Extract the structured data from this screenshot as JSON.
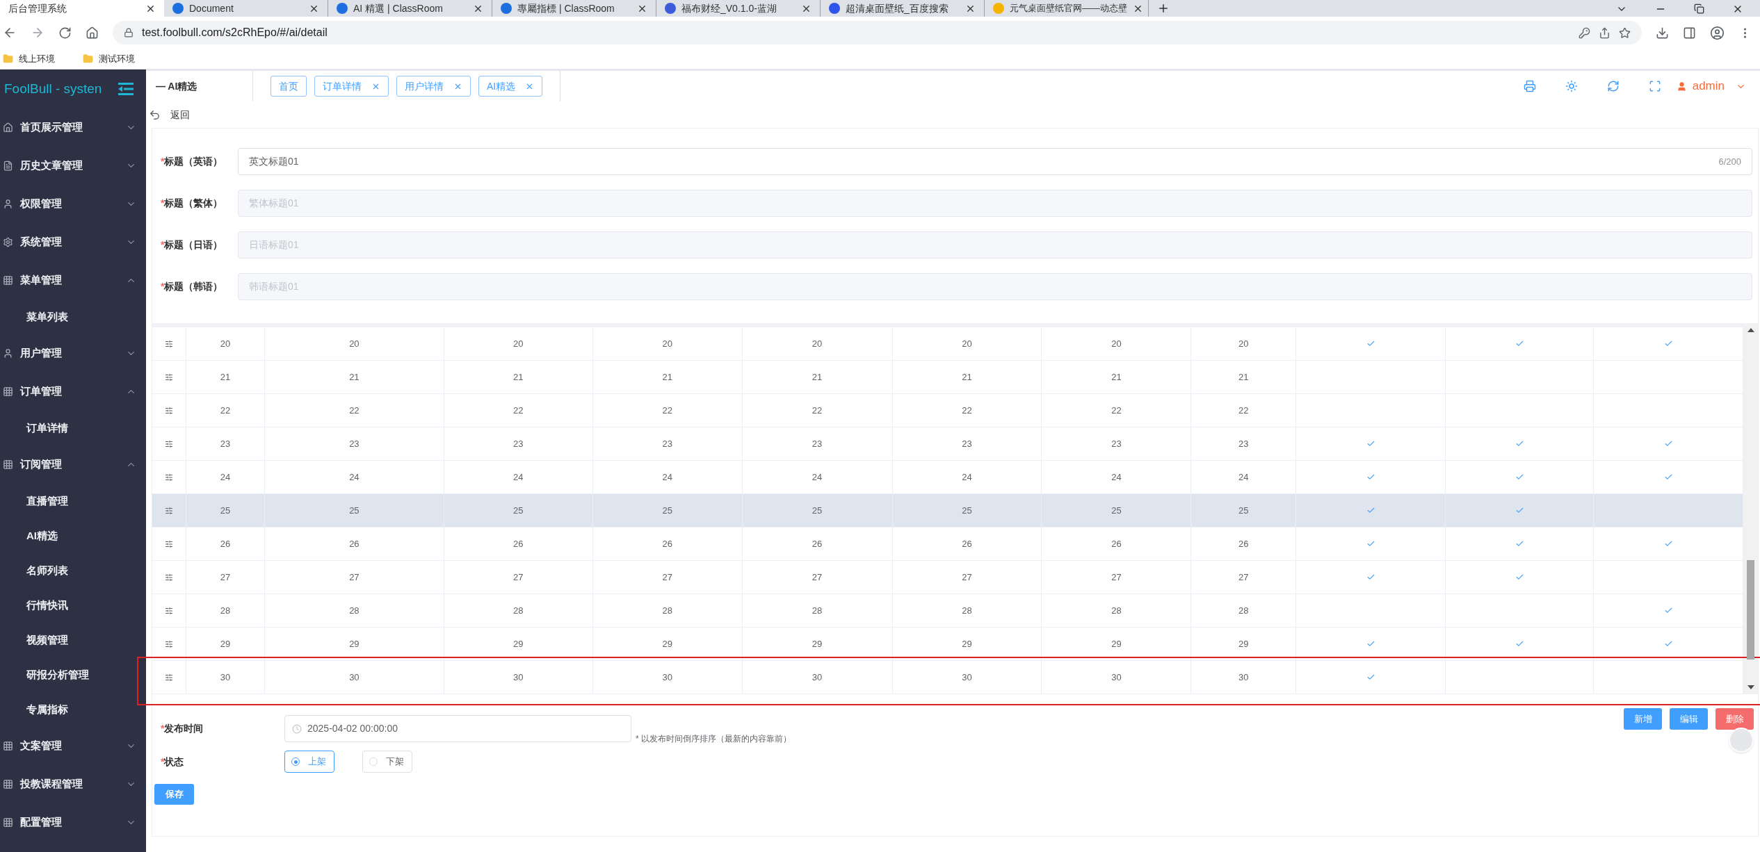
{
  "browser": {
    "tabs": [
      {
        "title": "后台管理系统",
        "selected": true
      },
      {
        "title": "Document",
        "selected": false
      },
      {
        "title": "AI 精選 | ClassRoom",
        "selected": false
      },
      {
        "title": "專屬指標 | ClassRoom",
        "selected": false
      },
      {
        "title": "福布财经_V0.1.0-蓝湖",
        "selected": false
      },
      {
        "title": "超清桌面壁纸_百度搜索",
        "selected": false
      },
      {
        "title": "元气桌面壁纸官网——动态壁",
        "selected": false
      }
    ],
    "url": "test.foolbull.com/s2cRhEpo/#/ai/detail",
    "bookmarks": [
      "线上环境",
      "测试环境"
    ]
  },
  "sidebar": {
    "logo": "FoolBull - systen",
    "items": [
      {
        "label": "首页展示管理",
        "expanded": false
      },
      {
        "label": "历史文章管理",
        "expanded": false
      },
      {
        "label": "权限管理",
        "expanded": false
      },
      {
        "label": "系统管理",
        "expanded": false
      },
      {
        "label": "菜单管理",
        "expanded": true,
        "children": [
          {
            "label": "菜单列表"
          }
        ]
      },
      {
        "label": "用户管理",
        "expanded": false
      },
      {
        "label": "订单管理",
        "expanded": true,
        "children": [
          {
            "label": "订单详情"
          }
        ]
      },
      {
        "label": "订阅管理",
        "expanded": true,
        "children": [
          {
            "label": "直播管理"
          },
          {
            "label": "AI精选"
          },
          {
            "label": "名师列表"
          },
          {
            "label": "行情快讯"
          },
          {
            "label": "视频管理"
          },
          {
            "label": "研报分析管理"
          },
          {
            "label": "专属指标"
          }
        ]
      },
      {
        "label": "文案管理",
        "expanded": false
      },
      {
        "label": "投教课程管理",
        "expanded": false
      },
      {
        "label": "配置管理",
        "expanded": false
      }
    ]
  },
  "header": {
    "breadcrumb": "— AI精选",
    "tabs": [
      {
        "label": "首页",
        "closable": false
      },
      {
        "label": "订单详情",
        "closable": true
      },
      {
        "label": "用户详情",
        "closable": true
      },
      {
        "label": "AI精选",
        "closable": true
      }
    ],
    "user": "admin"
  },
  "back": "返回",
  "fields": [
    {
      "required_mark": "*",
      "label": "标题（英语）",
      "value": "英文标题01",
      "disabled": false,
      "counter": "6/200"
    },
    {
      "required_mark": "*",
      "label": "标题（繁体）",
      "value": "繁体标题01",
      "disabled": true
    },
    {
      "required_mark": "*",
      "label": "标题（日语）",
      "value": "日语标题01",
      "disabled": true
    },
    {
      "required_mark": "*",
      "label": "标题（韩语）",
      "value": "韩语标题01",
      "disabled": true
    }
  ],
  "table": {
    "rows": [
      {
        "values": [
          "20",
          "20",
          "20",
          "20",
          "20",
          "20",
          "20",
          "20"
        ],
        "checks": [
          true,
          true,
          true
        ],
        "hovered": false,
        "outlined": false
      },
      {
        "values": [
          "21",
          "21",
          "21",
          "21",
          "21",
          "21",
          "21",
          "21"
        ],
        "checks": [
          false,
          false,
          false
        ],
        "hovered": false,
        "outlined": false
      },
      {
        "values": [
          "22",
          "22",
          "22",
          "22",
          "22",
          "22",
          "22",
          "22"
        ],
        "checks": [
          false,
          false,
          false
        ],
        "hovered": false,
        "outlined": false
      },
      {
        "values": [
          "23",
          "23",
          "23",
          "23",
          "23",
          "23",
          "23",
          "23"
        ],
        "checks": [
          true,
          true,
          true
        ],
        "hovered": false,
        "outlined": false
      },
      {
        "values": [
          "24",
          "24",
          "24",
          "24",
          "24",
          "24",
          "24",
          "24"
        ],
        "checks": [
          true,
          true,
          true
        ],
        "hovered": false,
        "outlined": false
      },
      {
        "values": [
          "25",
          "25",
          "25",
          "25",
          "25",
          "25",
          "25",
          "25"
        ],
        "checks": [
          true,
          true,
          false
        ],
        "hovered": true,
        "outlined": false
      },
      {
        "values": [
          "26",
          "26",
          "26",
          "26",
          "26",
          "26",
          "26",
          "26"
        ],
        "checks": [
          true,
          true,
          true
        ],
        "hovered": false,
        "outlined": false
      },
      {
        "values": [
          "27",
          "27",
          "27",
          "27",
          "27",
          "27",
          "27",
          "27"
        ],
        "checks": [
          true,
          true,
          false
        ],
        "hovered": false,
        "outlined": false
      },
      {
        "values": [
          "28",
          "28",
          "28",
          "28",
          "28",
          "28",
          "28",
          "28"
        ],
        "checks": [
          false,
          false,
          true
        ],
        "hovered": false,
        "outlined": false
      },
      {
        "values": [
          "29",
          "29",
          "29",
          "29",
          "29",
          "29",
          "29",
          "29"
        ],
        "checks": [
          true,
          true,
          true
        ],
        "hovered": false,
        "outlined": false
      },
      {
        "values": [
          "30",
          "30",
          "30",
          "30",
          "30",
          "30",
          "30",
          "30"
        ],
        "checks": [
          true,
          false,
          false
        ],
        "hovered": false,
        "outlined": true
      }
    ]
  },
  "table_actions": [
    {
      "label": "新增",
      "kind": "primary"
    },
    {
      "label": "编辑",
      "kind": "primary"
    },
    {
      "label": "删除",
      "kind": "danger"
    }
  ],
  "publish": {
    "required_mark": "*",
    "label": "发布时间",
    "value": "2025-04-02 00:00:00",
    "hint": "* 以发布时间倒序排序（最新的内容靠前）"
  },
  "status": {
    "required_mark": "*",
    "label": "状态",
    "options": [
      {
        "label": "上架",
        "selected": true
      },
      {
        "label": "下架",
        "selected": false
      }
    ]
  },
  "save": "保存"
}
